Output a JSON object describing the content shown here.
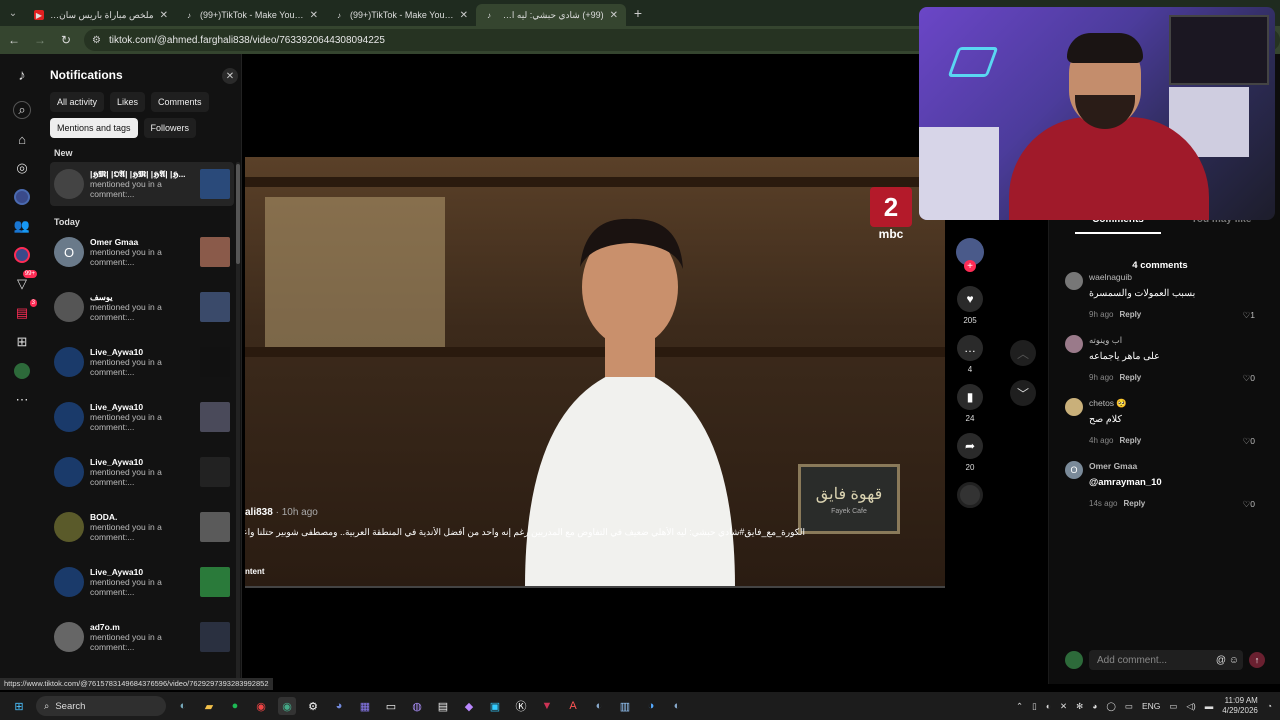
{
  "tabs": [
    {
      "title": "ملخص مباراة باريس سان جيرمان",
      "icon": "youtube-icon",
      "active": false
    },
    {
      "title": "(99+)TikTok - Make Your Day",
      "icon": "tiktok-icon",
      "active": false
    },
    {
      "title": "(99+)TikTok - Make Your Day",
      "icon": "tiktok-icon",
      "active": false
    },
    {
      "title": "(99+) شادي حبشي: ليه الأهلي...",
      "icon": "tiktok-icon",
      "active": true
    }
  ],
  "address": {
    "url": "tiktok.com/@ahmed.farghali838/video/7633920644308094225"
  },
  "rail": {
    "inbox_badge": "99+",
    "messages_badge": "3"
  },
  "notifications": {
    "title": "Notifications",
    "chips": [
      "All activity",
      "Likes",
      "Comments",
      "Mentions and tags",
      "Followers"
    ],
    "section_new": "New",
    "section_today": "Today",
    "items": [
      {
        "name": "|𝕳𝕸| |𝕺𝕬| |𝕳𝕸| |𝕳𝕬| |𝕳...",
        "action": "mentioned you in a comment:..."
      },
      {
        "name": "Omer Gmaa",
        "action": "mentioned you in a comment:..."
      },
      {
        "name": "يوسف",
        "action": "mentioned you in a comment:..."
      },
      {
        "name": "Live_Aywa10",
        "action": "mentioned you in a comment:..."
      },
      {
        "name": "Live_Aywa10",
        "action": "mentioned you in a comment:..."
      },
      {
        "name": "Live_Aywa10",
        "action": "mentioned you in a comment:..."
      },
      {
        "name": "BODA.",
        "action": "mentioned you in a comment:..."
      },
      {
        "name": "Live_Aywa10",
        "action": "mentioned you in a comment:..."
      },
      {
        "name": "ad7o.m",
        "action": "mentioned you in a comment:..."
      }
    ]
  },
  "video": {
    "channel_logo": "2",
    "channel_name": "mbc",
    "sign_text": "قهوة فايق",
    "sign_sub": "Fayek Cafe",
    "author": "ali838",
    "time": "· 10h ago",
    "caption": "الكورة_مع_فايق#شادي حبشي: ليه الأهلي ضعيف في التفاوض مع المدربين رغم إنه واحد من أفضل الأندية في المنطقة العربية.. ومصطفى شوبير حتلنا واعتقد",
    "more": "ntent"
  },
  "actions": {
    "likes": "205",
    "comments": "4",
    "saves": "24",
    "shares": "20"
  },
  "comments": {
    "tabs": [
      "Comments",
      "You may like"
    ],
    "count_label": "4 comments",
    "reply_label": "Reply",
    "items": [
      {
        "user": "waelnaguib",
        "text": "بسبب العمولات والسمسرة",
        "time": "9h ago",
        "likes": "1",
        "avatar_color": "#777777"
      },
      {
        "user": "اب وينوته",
        "text": "على ماهر ياجماعه",
        "time": "9h ago",
        "likes": "0",
        "avatar_color": "#9a7a8a"
      },
      {
        "user": "chetos 🥺",
        "text": "كلام صح",
        "time": "4h ago",
        "likes": "0",
        "avatar_color": "#c9b07a"
      },
      {
        "user": "Omer Gmaa",
        "text": "@amrayman_10",
        "time": "14s ago",
        "likes": "0",
        "avatar_color": "#7a8a99",
        "initial": "O"
      }
    ],
    "input_placeholder": "Add comment..."
  },
  "status_url": "https://www.tiktok.com/@7615783149684376596/video/7629297393283992852",
  "taskbar": {
    "search_label": "Search",
    "lang": "ENG",
    "time": "11:09 AM",
    "date": "4/29/2026"
  },
  "colors": {
    "accent": "#fe2c55",
    "browser_chrome": "#35452f"
  }
}
